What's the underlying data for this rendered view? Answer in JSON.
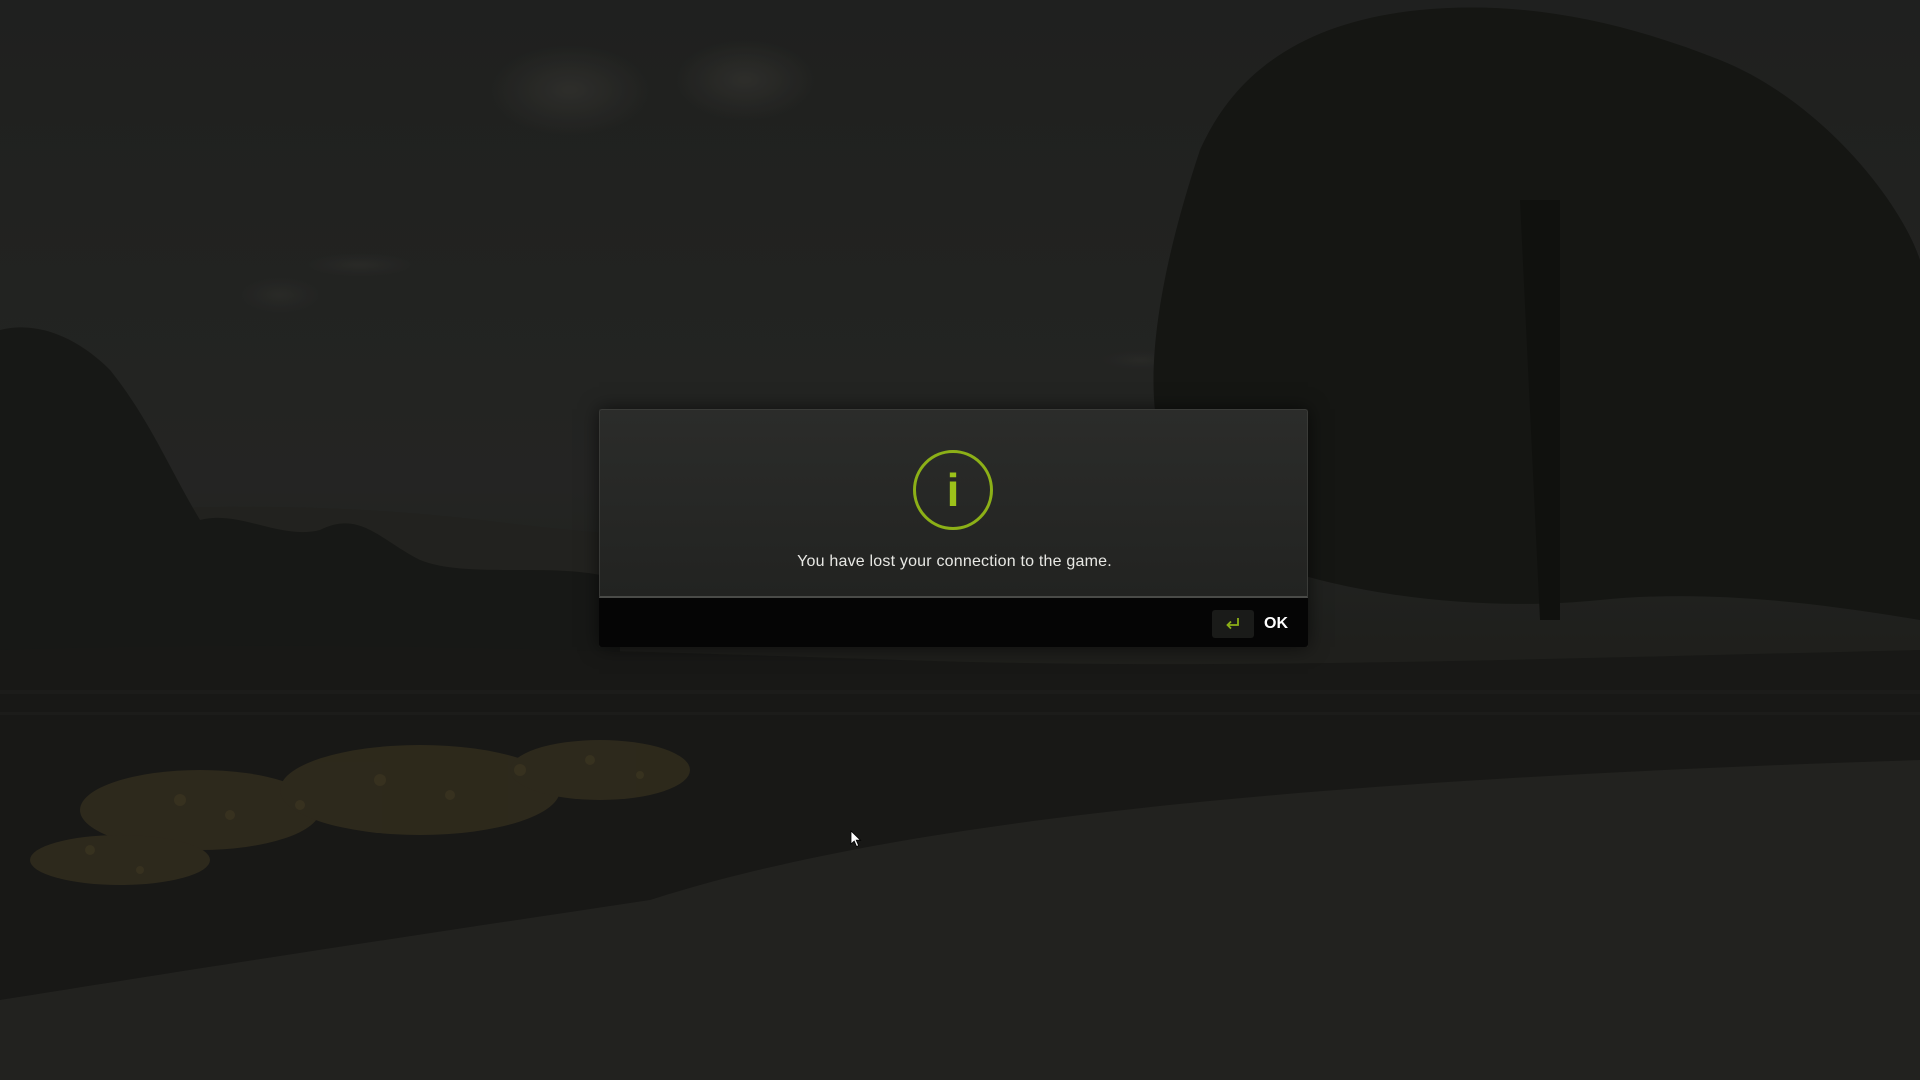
{
  "dialog": {
    "icon": "info-icon",
    "icon_glyph": "i",
    "message": "You have lost your connection to the game.",
    "ok_label": "OK",
    "ok_key_icon": "enter-key-icon"
  },
  "colors": {
    "accent": "#8cb017",
    "dialog_bg": "#262725",
    "footer_bg": "#050505",
    "text": "#e8e8e4"
  }
}
